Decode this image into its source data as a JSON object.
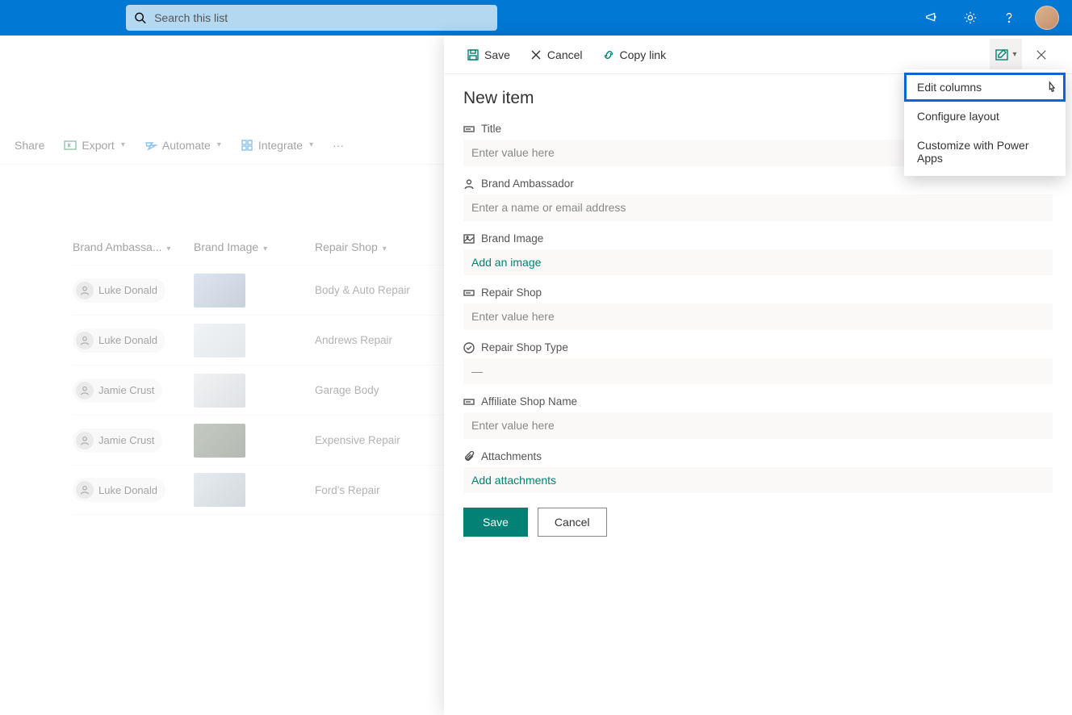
{
  "topbar": {
    "search_placeholder": "Search this list"
  },
  "cmdbar": {
    "share": "Share",
    "export": "Export",
    "automate": "Automate",
    "integrate": "Integrate"
  },
  "list": {
    "headers": {
      "ambassador": "Brand Ambassa...",
      "image": "Brand Image",
      "repair": "Repair Shop"
    },
    "rows": [
      {
        "name": "Luke Donald",
        "repair": "Body & Auto Repair"
      },
      {
        "name": "Luke Donald",
        "repair": "Andrews Repair"
      },
      {
        "name": "Jamie Crust",
        "repair": "Garage Body"
      },
      {
        "name": "Jamie Crust",
        "repair": "Expensive Repair"
      },
      {
        "name": "Luke Donald",
        "repair": "Ford's Repair"
      }
    ]
  },
  "panel": {
    "toolbar": {
      "save": "Save",
      "cancel": "Cancel",
      "copylink": "Copy link"
    },
    "title": "New item",
    "fields": {
      "title_label": "Title",
      "title_ph": "Enter value here",
      "ba_label": "Brand Ambassador",
      "ba_ph": "Enter a name or email address",
      "bi_label": "Brand Image",
      "bi_action": "Add an image",
      "rs_label": "Repair Shop",
      "rs_ph": "Enter value here",
      "rst_label": "Repair Shop Type",
      "rst_value": "—",
      "asn_label": "Affiliate Shop Name",
      "asn_ph": "Enter value here",
      "att_label": "Attachments",
      "att_action": "Add attachments"
    },
    "buttons": {
      "save": "Save",
      "cancel": "Cancel"
    }
  },
  "dropdown": {
    "edit_columns": "Edit columns",
    "configure_layout": "Configure layout",
    "customize_powerapps": "Customize with Power Apps"
  }
}
